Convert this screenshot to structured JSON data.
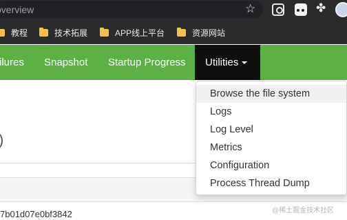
{
  "browser": {
    "url_text": "overview",
    "bookmarks": [
      {
        "label": "教程"
      },
      {
        "label": "技术拓展"
      },
      {
        "label": "APP线上平台"
      },
      {
        "label": "资源网站"
      }
    ]
  },
  "nav": {
    "items": [
      "ilures",
      "Snapshot",
      "Startup Progress"
    ],
    "utilities_label": "Utilities"
  },
  "dropdown": {
    "items": [
      "Browse the file system",
      "Logs",
      "Log Level",
      "Metrics",
      "Configuration",
      "Process Thread Dump"
    ]
  },
  "page": {
    "paren": ")",
    "hash": "7b01d07e0bf3842"
  },
  "watermark": "@稀土掘金技术社区"
}
